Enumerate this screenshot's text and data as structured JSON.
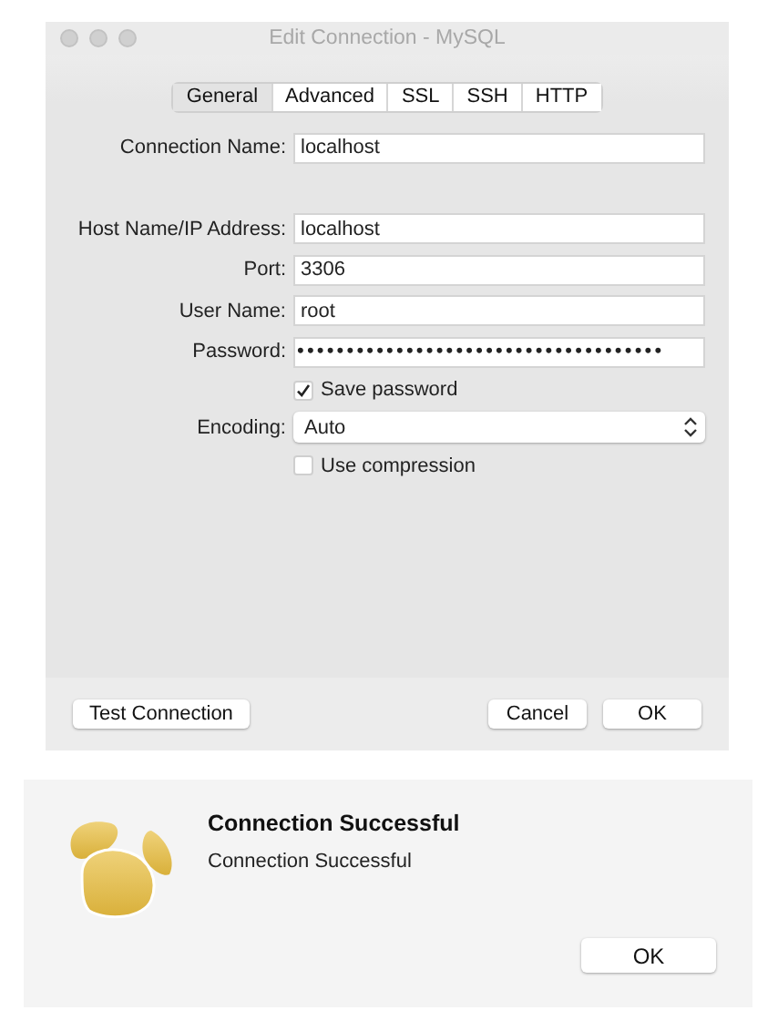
{
  "window": {
    "title": "Edit Connection - MySQL"
  },
  "tabs": [
    {
      "label": "General",
      "selected": true
    },
    {
      "label": "Advanced",
      "selected": false
    },
    {
      "label": "SSL",
      "selected": false
    },
    {
      "label": "SSH",
      "selected": false
    },
    {
      "label": "HTTP",
      "selected": false
    }
  ],
  "connection_name": {
    "label": "Connection Name:",
    "value": "localhost"
  },
  "fields": [
    {
      "kind": "text",
      "label": "Host Name/IP Address:",
      "value": "localhost"
    },
    {
      "kind": "text",
      "label": "Port:",
      "value": "3306"
    },
    {
      "kind": "text",
      "label": "User Name:",
      "value": "root"
    },
    {
      "kind": "password",
      "label": "Password:",
      "value": "•••••••••••••••••••••••••••••••••••••"
    },
    {
      "kind": "checkbox",
      "label": "Save password",
      "checked": true
    },
    {
      "kind": "select",
      "label": "Encoding:",
      "value": "Auto"
    },
    {
      "kind": "checkbox",
      "label": "Use compression",
      "checked": false
    }
  ],
  "buttons": {
    "test": "Test Connection",
    "cancel": "Cancel",
    "ok": "OK"
  },
  "alert": {
    "title": "Connection Successful",
    "message": "Connection Successful",
    "button": "OK"
  }
}
